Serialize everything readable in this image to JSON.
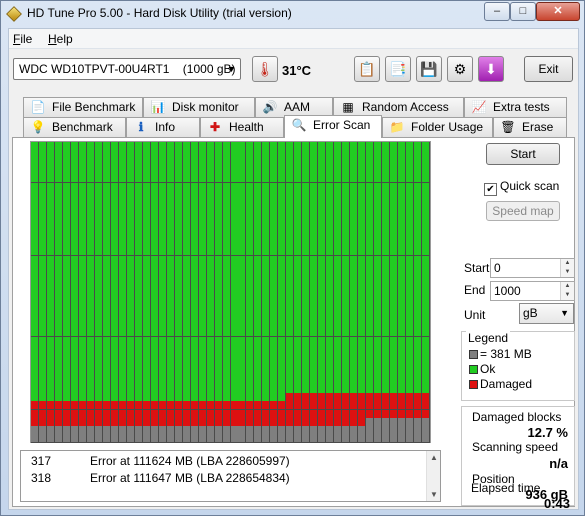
{
  "window": {
    "title": "HD Tune Pro 5.00 - Hard Disk Utility (trial version)",
    "controls": {
      "minimize": "–",
      "maximize": "□",
      "close": "✕"
    }
  },
  "menu": {
    "file_u": "F",
    "file_rest": "ile",
    "help_u": "H",
    "help_rest": "elp"
  },
  "toolbar": {
    "drive": "WDC WD10TPVT-00U4RT1    (1000 gB)",
    "temperature": "31°C",
    "exit_label": "Exit",
    "icons": [
      "thermometer-icon",
      "copy-text-icon",
      "copy-screenshot-icon",
      "save-icon",
      "settings-icon",
      "download-icon"
    ]
  },
  "tabs_top": [
    "File Benchmark",
    "Disk monitor",
    "AAM",
    "Random Access",
    "Extra tests"
  ],
  "tabs_bottom": [
    "Benchmark",
    "Info",
    "Health",
    "Error Scan",
    "Folder Usage",
    "Erase"
  ],
  "active_tab": "Error Scan",
  "scan": {
    "start_button": "Start",
    "quick_scan_label": "Quick scan",
    "quick_scan_checked": true,
    "speed_map_button": "Speed map",
    "start_label": "Start",
    "start_value": "0",
    "end_label": "End",
    "end_value": "1000",
    "unit_label": "Unit",
    "unit_value": "gB"
  },
  "legend": {
    "title": "Legend",
    "items": [
      {
        "label": "= 381 MB",
        "color": "#7f7f7f"
      },
      {
        "label": "Ok",
        "color": "#22cc22"
      },
      {
        "label": "Damaged",
        "color": "#dd1111"
      }
    ]
  },
  "stats": {
    "damaged_blocks_label": "Damaged blocks",
    "damaged_blocks_value": "12.7 %",
    "scanning_speed_label": "Scanning speed",
    "scanning_speed_value": "n/a",
    "position_label": "Position",
    "position_value": "936 gB",
    "elapsed_time_label": "Elapsed time",
    "elapsed_time_value": "0:43"
  },
  "log": [
    {
      "num": "317",
      "msg": "Error at 111624 MB (LBA 228605997)"
    },
    {
      "num": "318",
      "msg": "Error at 111647 MB (LBA 228654834)"
    }
  ],
  "block_map": {
    "columns": 50,
    "rows": 37,
    "colors": {
      "ok": "#22cc22",
      "damaged": "#dd1111",
      "unscanned": "#7f7f7f"
    },
    "damaged_start_row": 32,
    "damaged_start_row_right_part": 31,
    "right_part_from_column": 32,
    "unscanned_start_row": 35,
    "unscanned_start_row_right_part": 34,
    "unscanned_right_part_from_column": 42
  }
}
